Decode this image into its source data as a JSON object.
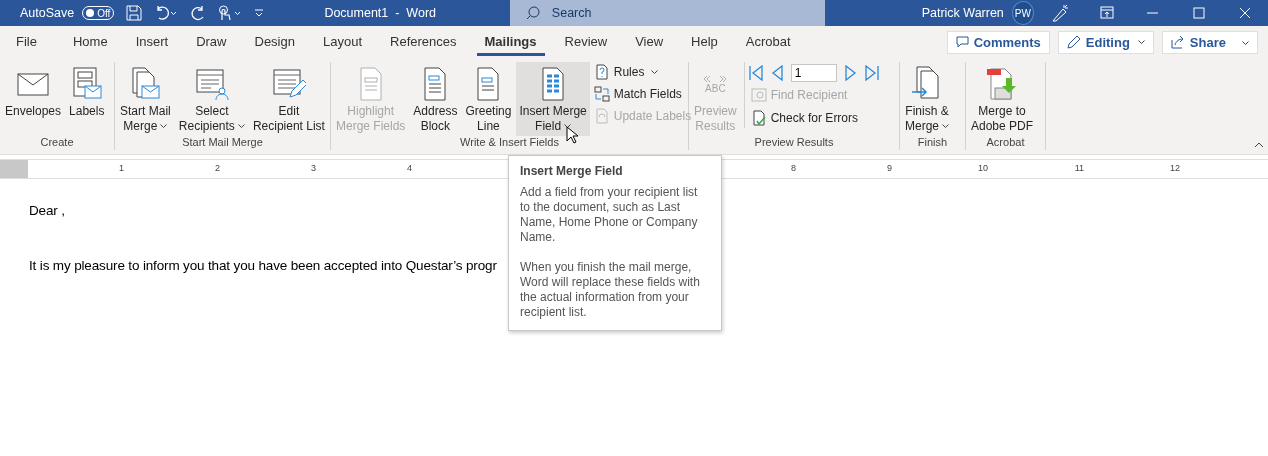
{
  "title_bar": {
    "autosave": {
      "label": "AutoSave",
      "on": false,
      "state_text": "Off"
    },
    "document_title": "Document1  -  Word",
    "search": {
      "placeholder": "Search"
    },
    "user_name": "Patrick Warren",
    "avatar_initials": "PW"
  },
  "tabs": [
    {
      "label": "File",
      "selected": false
    },
    {
      "label": "Home",
      "selected": false
    },
    {
      "label": "Insert",
      "selected": false
    },
    {
      "label": "Draw",
      "selected": false
    },
    {
      "label": "Design",
      "selected": false
    },
    {
      "label": "Layout",
      "selected": false
    },
    {
      "label": "References",
      "selected": false
    },
    {
      "label": "Mailings",
      "selected": true
    },
    {
      "label": "Review",
      "selected": false
    },
    {
      "label": "View",
      "selected": false
    },
    {
      "label": "Help",
      "selected": false
    },
    {
      "label": "Acrobat",
      "selected": false
    }
  ],
  "actions": {
    "comments": "Comments",
    "editing": "Editing",
    "share": "Share"
  },
  "ribbon": {
    "groups": [
      {
        "label": "Create",
        "buttons": [
          {
            "lines": [
              "Envelopes"
            ],
            "dropdown": false,
            "disabled": false,
            "hovered": false
          },
          {
            "lines": [
              "Labels"
            ],
            "dropdown": false,
            "disabled": false,
            "hovered": false
          }
        ]
      },
      {
        "label": "Start Mail Merge",
        "buttons": [
          {
            "lines": [
              "Start Mail",
              "Merge"
            ],
            "dropdown": true,
            "disabled": false,
            "hovered": false
          },
          {
            "lines": [
              "Select",
              "Recipients"
            ],
            "dropdown": true,
            "disabled": false,
            "hovered": false
          },
          {
            "lines": [
              "Edit",
              "Recipient List"
            ],
            "dropdown": false,
            "disabled": false,
            "hovered": false
          }
        ]
      },
      {
        "label": "Write & Insert Fields",
        "buttons": [
          {
            "lines": [
              "Highlight",
              "Merge Fields"
            ],
            "dropdown": false,
            "disabled": true,
            "hovered": false
          },
          {
            "lines": [
              "Address",
              "Block"
            ],
            "dropdown": false,
            "disabled": false,
            "hovered": false
          },
          {
            "lines": [
              "Greeting",
              "Line"
            ],
            "dropdown": false,
            "disabled": false,
            "hovered": false
          },
          {
            "lines": [
              "Insert Merge",
              "Field"
            ],
            "dropdown": true,
            "disabled": false,
            "hovered": true
          }
        ],
        "small_buttons": [
          {
            "label": "Rules",
            "dropdown": true,
            "disabled": false
          },
          {
            "label": "Match Fields",
            "dropdown": false,
            "disabled": false
          },
          {
            "label": "Update Labels",
            "dropdown": false,
            "disabled": true
          }
        ]
      },
      {
        "label": "Preview Results",
        "buttons": [
          {
            "lines": [
              "Preview",
              "Results"
            ],
            "dropdown": false,
            "disabled": true,
            "hovered": false,
            "icon_text": "ABC"
          }
        ],
        "record": "1",
        "small_buttons": [
          {
            "label": "Find Recipient",
            "dropdown": false,
            "disabled": true
          },
          {
            "label": "Check for Errors",
            "dropdown": false,
            "disabled": false
          }
        ]
      },
      {
        "label": "Finish",
        "buttons": [
          {
            "lines": [
              "Finish &",
              "Merge"
            ],
            "dropdown": true,
            "disabled": false,
            "hovered": false
          }
        ]
      },
      {
        "label": "Acrobat",
        "buttons": [
          {
            "lines": [
              "Merge to",
              "Adobe PDF"
            ],
            "dropdown": false,
            "disabled": false,
            "hovered": false
          }
        ]
      }
    ]
  },
  "ruler": {
    "left_numbers": [
      "1",
      "2",
      "3",
      "4"
    ],
    "right_numbers": [
      "8",
      "9",
      "10",
      "11",
      "12"
    ]
  },
  "document": {
    "paragraphs": [
      "Dear ,",
      "It is my pleasure to inform you that you have been accepted into Questar’s progr"
    ]
  },
  "tooltip": {
    "title": "Insert Merge Field",
    "paragraphs": [
      "Add a field from your recipient list to the document, such as Last Name, Home Phone or Company Name.",
      "When you finish the mail merge, Word will replace these fields with the actual information from your recipient list."
    ]
  }
}
